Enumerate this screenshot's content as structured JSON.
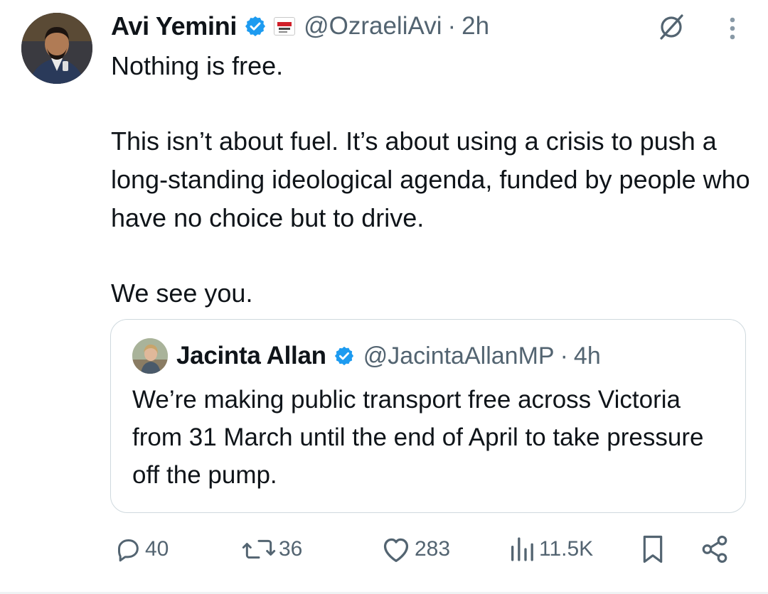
{
  "tweet": {
    "author": {
      "name": "Avi Yemini",
      "handle": "@OzraeliAvi",
      "time": "2h",
      "separator": "·",
      "affiliation_badge_text": "REBEL NEWS",
      "verified_color": "#1d9bf0"
    },
    "text_lines": [
      "Nothing is free.",
      "This isn’t about fuel. It’s about using a crisis to push a long-standing ideological agenda, funded by people who have no choice but to drive.",
      "We see you."
    ],
    "quote": {
      "author": {
        "name": "Jacinta Allan",
        "handle": "@JacintaAllanMP",
        "time": "4h",
        "separator": "·"
      },
      "text": "We’re making public transport free across Victoria from 31 March until the end of April to take pressure off the pump."
    },
    "actions": {
      "replies": "40",
      "reposts": "36",
      "likes": "283",
      "views": "11.5K"
    }
  },
  "colors": {
    "text": "#0f1419",
    "secondary": "#536471",
    "border": "#cfd9de",
    "verified": "#1d9bf0"
  },
  "icons": {
    "grok": "grok-icon",
    "more": "more-vertical-icon",
    "reply": "reply-icon",
    "repost": "repost-icon",
    "like": "heart-icon",
    "views": "views-icon",
    "bookmark": "bookmark-icon",
    "share": "share-icon"
  }
}
